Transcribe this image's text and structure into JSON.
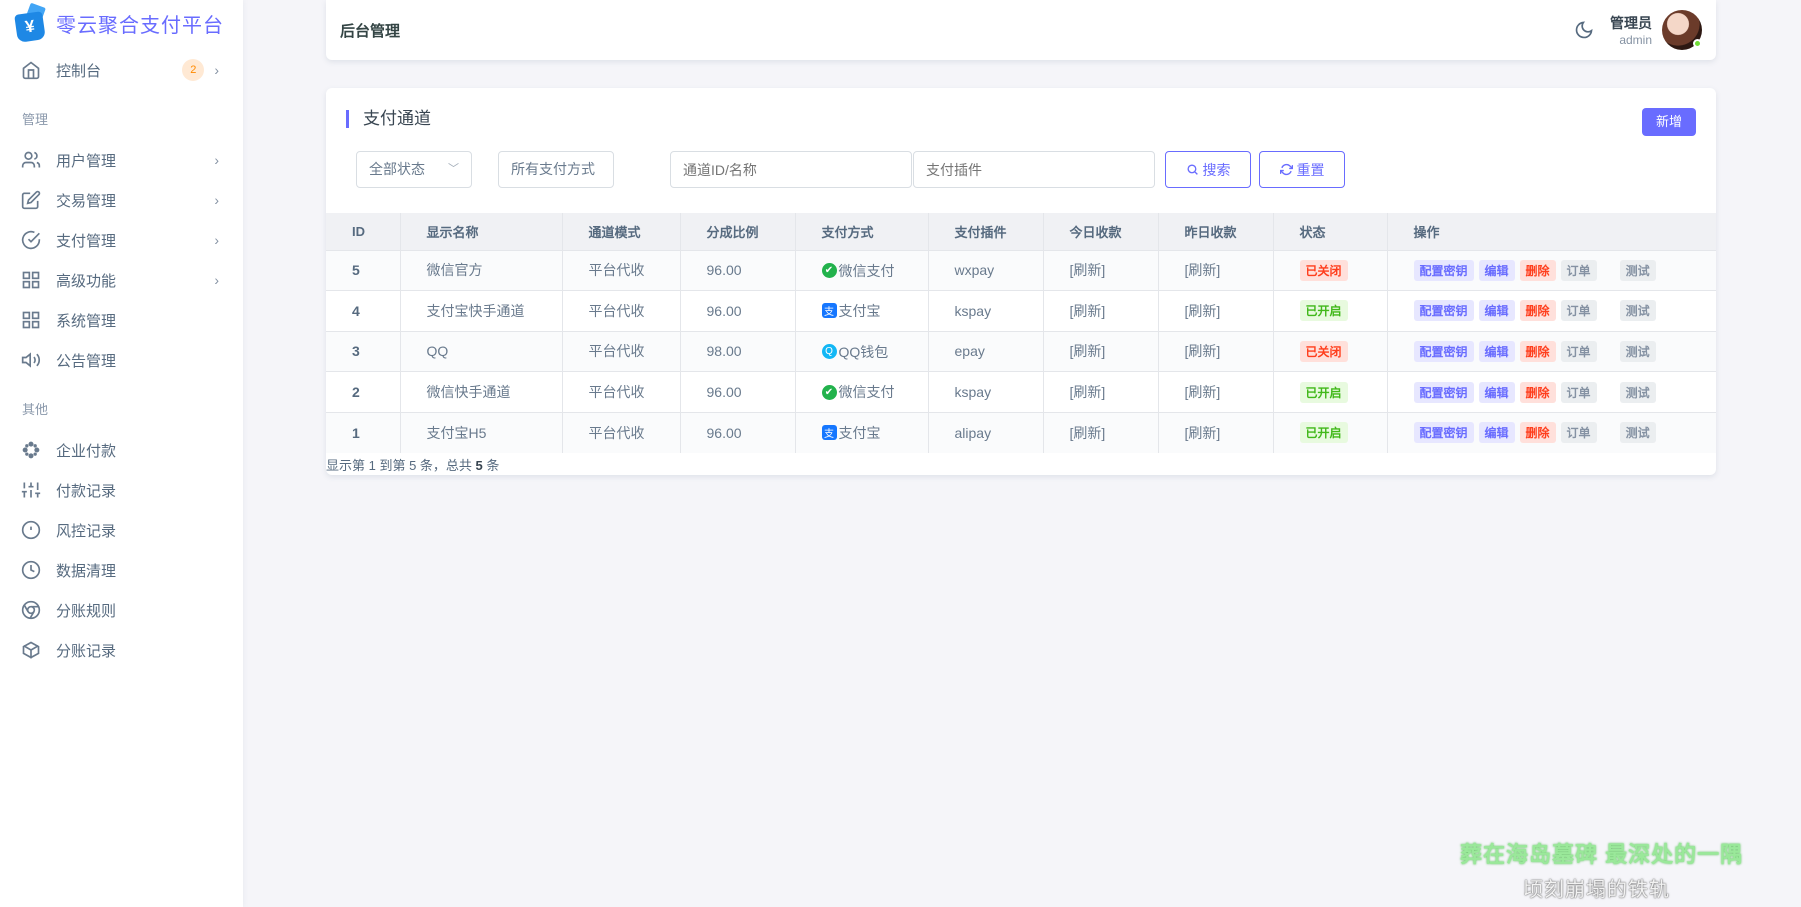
{
  "brand": {
    "title": "零云聚合支付平台"
  },
  "sidebar": {
    "dashboard": {
      "label": "控制台",
      "badge": "2"
    },
    "section_manage": "管理",
    "manage_items": [
      {
        "label": "用户管理",
        "icon": "users-icon"
      },
      {
        "label": "交易管理",
        "icon": "edit-icon"
      },
      {
        "label": "支付管理",
        "icon": "check-circle-icon"
      },
      {
        "label": "高级功能",
        "icon": "grid-icon"
      },
      {
        "label": "系统管理",
        "icon": "grid-icon"
      },
      {
        "label": "公告管理",
        "icon": "speaker-icon"
      }
    ],
    "section_other": "其他",
    "other_items": [
      {
        "label": "企业付款",
        "icon": "flower-icon"
      },
      {
        "label": "付款记录",
        "icon": "sliders-icon"
      },
      {
        "label": "风控记录",
        "icon": "alert-icon"
      },
      {
        "label": "数据清理",
        "icon": "clock-icon"
      },
      {
        "label": "分账规则",
        "icon": "chrome-icon"
      },
      {
        "label": "分账记录",
        "icon": "codesandbox-icon"
      }
    ]
  },
  "navbar": {
    "title": "后台管理",
    "user_name": "管理员",
    "user_role": "admin"
  },
  "card": {
    "title": "支付通道",
    "new_button": "新增",
    "filters": {
      "status_value": "全部状态",
      "method_value": "所有支付方式",
      "id_placeholder": "通道ID/名称",
      "plugin_placeholder": "支付插件",
      "search_button": "搜索",
      "reset_button": "重置"
    },
    "columns": [
      "ID",
      "显示名称",
      "通道模式",
      "分成比例",
      "支付方式",
      "支付插件",
      "今日收款",
      "昨日收款",
      "状态",
      "操作"
    ],
    "rows": [
      {
        "id": "5",
        "name": "微信官方",
        "mode": "平台代收",
        "rate": "96.00",
        "method": "微信支付",
        "method_type": "wx",
        "plugin": "wxpay",
        "today": "[刷新]",
        "yesterday": "[刷新]",
        "status": "已关闭",
        "status_type": "off"
      },
      {
        "id": "4",
        "name": "支付宝快手通道",
        "mode": "平台代收",
        "rate": "96.00",
        "method": "支付宝",
        "method_type": "ali",
        "plugin": "kspay",
        "today": "[刷新]",
        "yesterday": "[刷新]",
        "status": "已开启",
        "status_type": "on"
      },
      {
        "id": "3",
        "name": "QQ",
        "mode": "平台代收",
        "rate": "98.00",
        "method": "QQ钱包",
        "method_type": "qq",
        "plugin": "epay",
        "today": "[刷新]",
        "yesterday": "[刷新]",
        "status": "已关闭",
        "status_type": "off"
      },
      {
        "id": "2",
        "name": "微信快手通道",
        "mode": "平台代收",
        "rate": "96.00",
        "method": "微信支付",
        "method_type": "wx",
        "plugin": "kspay",
        "today": "[刷新]",
        "yesterday": "[刷新]",
        "status": "已开启",
        "status_type": "on"
      },
      {
        "id": "1",
        "name": "支付宝H5",
        "mode": "平台代收",
        "rate": "96.00",
        "method": "支付宝",
        "method_type": "ali",
        "plugin": "alipay",
        "today": "[刷新]",
        "yesterday": "[刷新]",
        "status": "已开启",
        "status_type": "on"
      }
    ],
    "actions": {
      "key": "配置密钥",
      "edit": "编辑",
      "delete": "删除",
      "order": "订单",
      "test": "测试"
    },
    "pagination_prefix": "显示第 1 到第 5 条，总共 ",
    "pagination_total": "5",
    "pagination_suffix": " 条"
  },
  "overlay": {
    "lyric_line1": "葬在海岛墓碑 最深处的一隅",
    "lyric_line2": "顷刻崩塌的铁轨"
  },
  "colors": {
    "primary": "#696cff",
    "danger": "#ff3e1d",
    "success": "#71dd37"
  }
}
